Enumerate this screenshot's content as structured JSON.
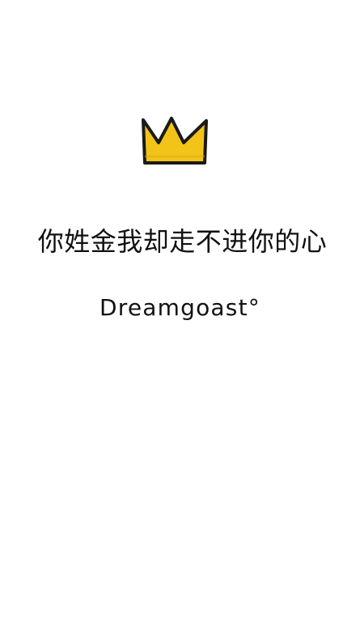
{
  "crown": {
    "icon": "crown-icon",
    "fill": "#f2c318",
    "stroke": "#1a1a1a"
  },
  "headline": {
    "text": "你姓金我却走不进你的心"
  },
  "signature": {
    "text": "Dreamgoast°"
  }
}
